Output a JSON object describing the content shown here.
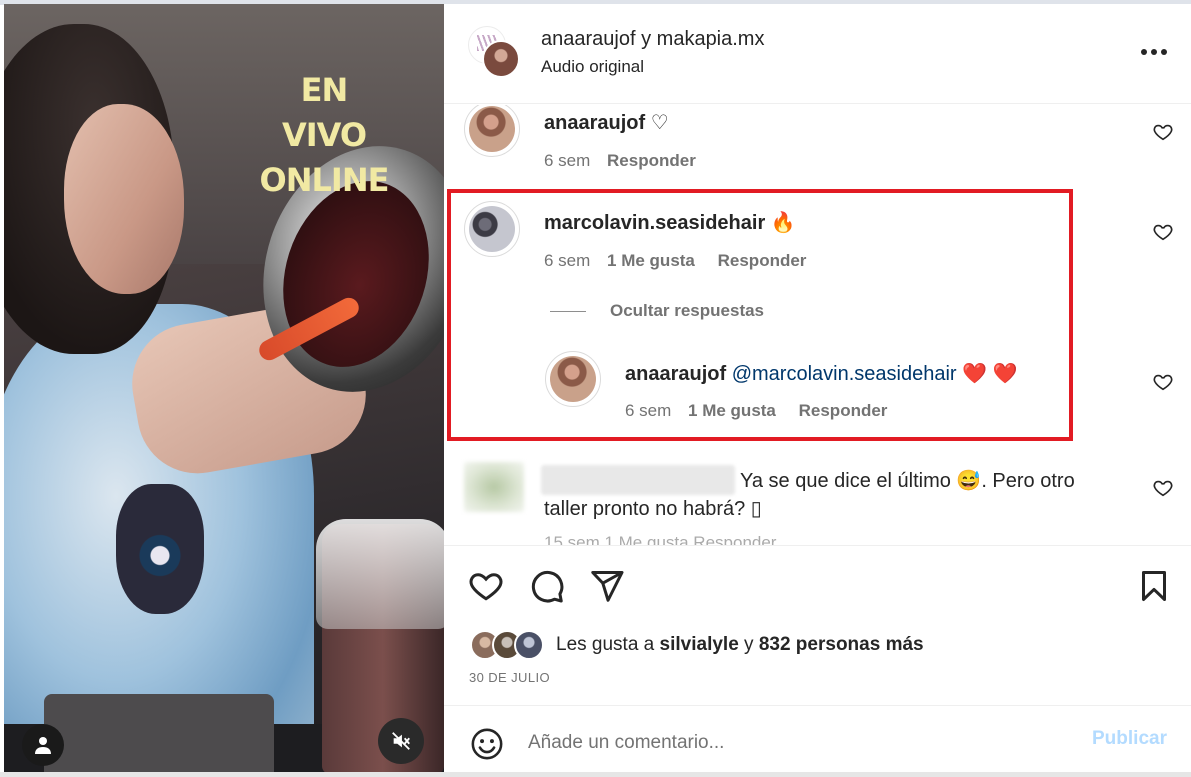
{
  "media": {
    "overlay_text_line1": "EN VIVO",
    "overlay_text_line2": "ONLINE",
    "user_icon": "user-icon",
    "mute_icon": "speaker-muted-icon"
  },
  "header": {
    "title_user1": "anaaraujof",
    "title_join": "y",
    "title_user2": "makapia.mx",
    "subtitle": "Audio original",
    "more_icon": "more-dots-icon"
  },
  "comments": [
    {
      "user": "anaaraujof",
      "suffix": "♡",
      "time": "6 sem",
      "likes": "",
      "reply_label": "Responder"
    },
    {
      "user": "marcolavin.seasidehair",
      "suffix": "🔥",
      "time": "6 sem",
      "likes": "1 Me gusta",
      "reply_label": "Responder",
      "hide_replies_label": "Ocultar respuestas",
      "replies": [
        {
          "user": "anaaraujof",
          "mention": "@marcolavin.seasidehair",
          "suffix": "❤️ ❤️",
          "time": "6 sem",
          "likes": "1 Me gusta",
          "reply_label": "Responder"
        }
      ]
    },
    {
      "user": "",
      "text_line1": "Ya se que dice el último 😅. Pero otro",
      "text_line2": "taller pronto no habrá? ▯",
      "partial_meta": "15 sem  1 Me gusta  Responder"
    }
  ],
  "actions": {
    "like_icon": "heart-icon",
    "comment_icon": "comment-bubble-icon",
    "share_icon": "paper-plane-icon",
    "save_icon": "bookmark-icon",
    "likes_prefix": "Les gusta a",
    "likes_user": "silvialyle",
    "likes_join": "y",
    "likes_others": "832 personas más",
    "date": "30 DE JULIO"
  },
  "add_comment": {
    "emoji_icon": "emoji-smile-icon",
    "placeholder": "Añade un comentario...",
    "publish_label": "Publicar"
  },
  "colors": {
    "highlight": "#e21b23",
    "mention": "#00376b",
    "publish_disabled": "#b3dbff",
    "meta_gray": "#737373"
  }
}
